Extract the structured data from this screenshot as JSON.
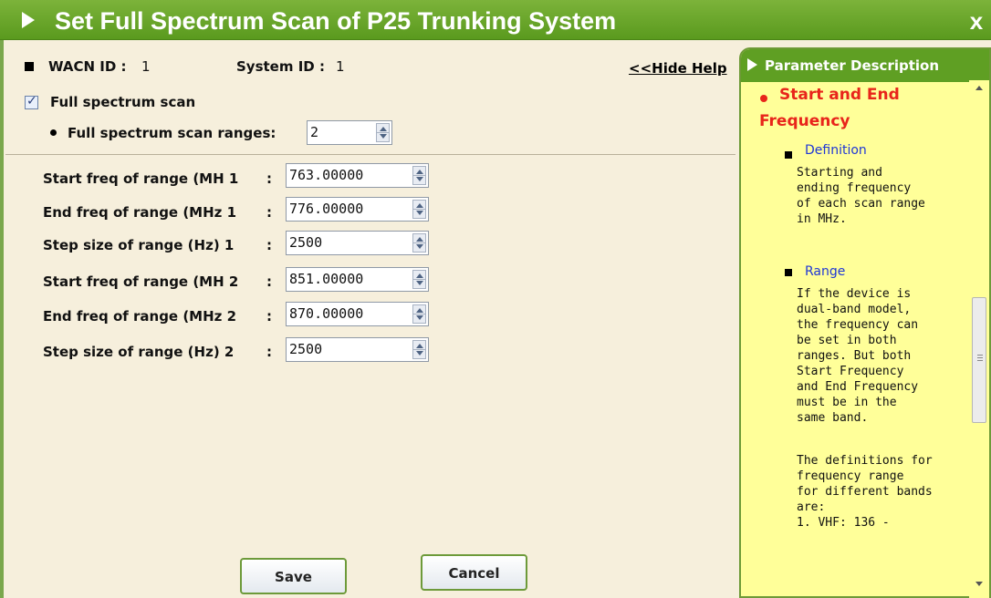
{
  "dialog": {
    "title": "Set Full Spectrum Scan of P25 Trunking System",
    "close_label": "x"
  },
  "header": {
    "wacn_label": "WACN ID :",
    "wacn_value": "1",
    "system_label": "System ID :",
    "system_value": "1",
    "hide_help": "<<Hide Help"
  },
  "scan": {
    "checkbox_label": "Full spectrum scan",
    "checked": true,
    "ranges_label": "Full spectrum scan ranges:",
    "ranges_value": "2"
  },
  "rows": [
    {
      "label": "Start freq of range (MH 1",
      "colon": ":",
      "value": "763.00000"
    },
    {
      "label": "End freq of range (MHz 1",
      "colon": ":",
      "value": "776.00000"
    },
    {
      "label": "Step size of range (Hz) 1",
      "colon": ":",
      "value": "2500"
    },
    {
      "label": "Start freq of range (MH 2",
      "colon": ":",
      "value": "851.00000"
    },
    {
      "label": "End freq of range (MHz 2",
      "colon": ":",
      "value": "870.00000"
    },
    {
      "label": "Step size of range (Hz) 2",
      "colon": ":",
      "value": "2500"
    }
  ],
  "buttons": {
    "save": "Save",
    "cancel": "Cancel"
  },
  "help": {
    "title": "Parameter Description",
    "heading_line1": "Start and End",
    "heading_line2": "Frequency",
    "definition_title": "Definition",
    "definition_lines": [
      "Starting and",
      "ending frequency",
      "of each scan range",
      "in MHz."
    ],
    "range_title": "Range",
    "range_lines": [
      "If the device is",
      "dual-band model,",
      "the frequency can",
      "be set in both",
      "ranges. But both",
      "Start Frequency",
      "and End Frequency",
      "must be in the",
      "same band.",
      "",
      "The definitions for",
      "frequency range",
      "for different bands",
      "are:",
      "1. VHF: 136 -"
    ]
  },
  "colors": {
    "title_green": "#5a9a1e",
    "panel_yellow": "#ffff99",
    "heading_red": "#e8251b",
    "link_blue": "#1f37d6",
    "background": "#f6efdc"
  },
  "icons": {
    "title": "play-triangle-icon",
    "close": "close-icon",
    "checkbox": "checkmark-icon",
    "spinner": "spinner-arrows-icon"
  }
}
